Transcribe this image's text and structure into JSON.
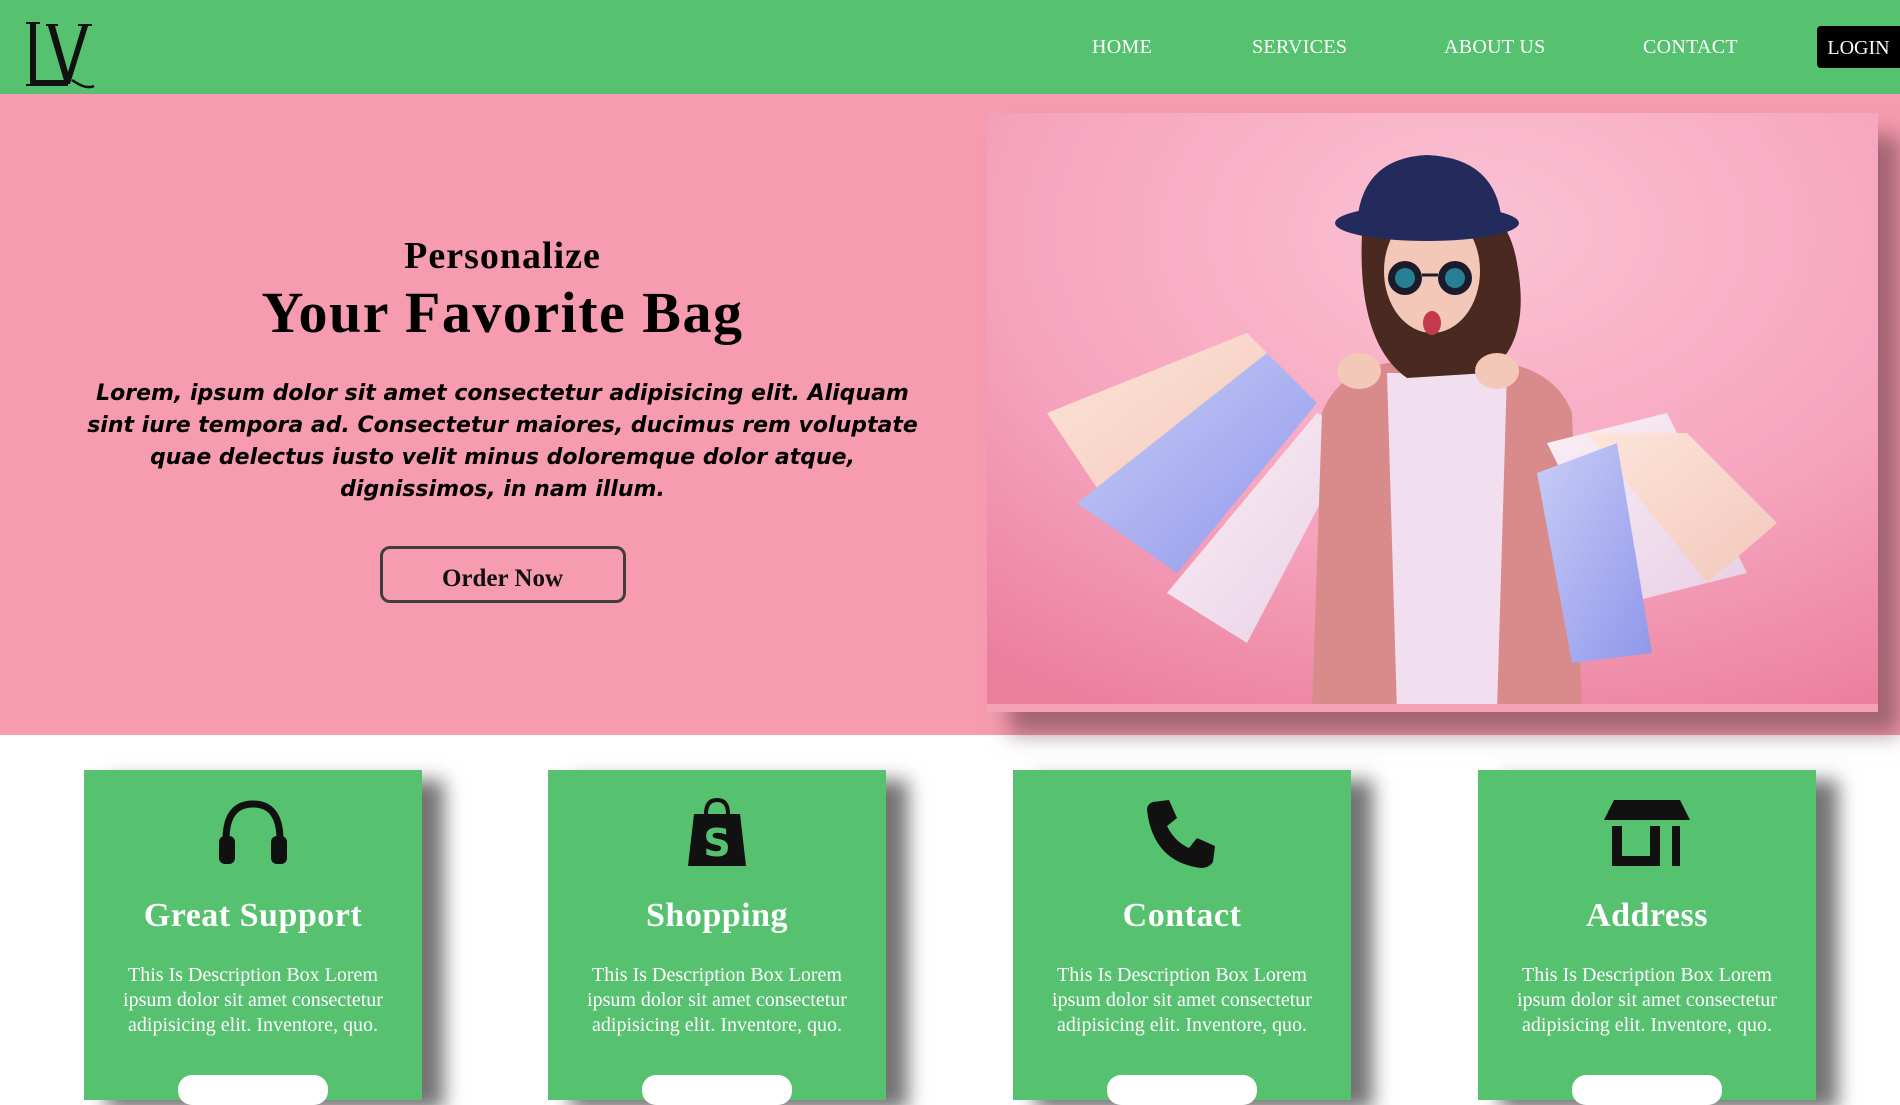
{
  "brand": {
    "logo_icon": "lv-monogram-logo"
  },
  "nav": {
    "links": [
      "HOME",
      "SERVICES",
      "ABOUT US",
      "CONTACT"
    ],
    "login": "LOGIN"
  },
  "hero": {
    "subtitle": "Personalize",
    "title": "Your Favorite Bag",
    "description": "Lorem, ipsum dolor sit amet consectetur adipisicing elit. Aliquam sint iure tempora ad. Consectetur maiores, ducimus rem voluptate quae delectus iusto velit minus doloremque dolor atque, dignissimos, in nam illum.",
    "cta": "Order Now",
    "image": "woman-with-shopping-bags-photo"
  },
  "features": [
    {
      "icon": "headphones-icon",
      "title": "Great Support",
      "description": "This Is Description Box Lorem ipsum dolor sit amet consectetur adipisicing elit. Inventore, quo."
    },
    {
      "icon": "shopping-bag-icon",
      "title": "Shopping",
      "description": "This Is Description Box Lorem ipsum dolor sit amet consectetur adipisicing elit. Inventore, quo."
    },
    {
      "icon": "phone-icon",
      "title": "Contact",
      "description": "This Is Description Box Lorem ipsum dolor sit amet consectetur adipisicing elit. Inventore, quo."
    },
    {
      "icon": "store-icon",
      "title": "Address",
      "description": "This Is Description Box Lorem ipsum dolor sit amet consectetur adipisicing elit. Inventore, quo."
    }
  ],
  "colors": {
    "green": "#56c16f",
    "pink": "#f79cb0",
    "black": "#000000",
    "white": "#ffffff"
  }
}
